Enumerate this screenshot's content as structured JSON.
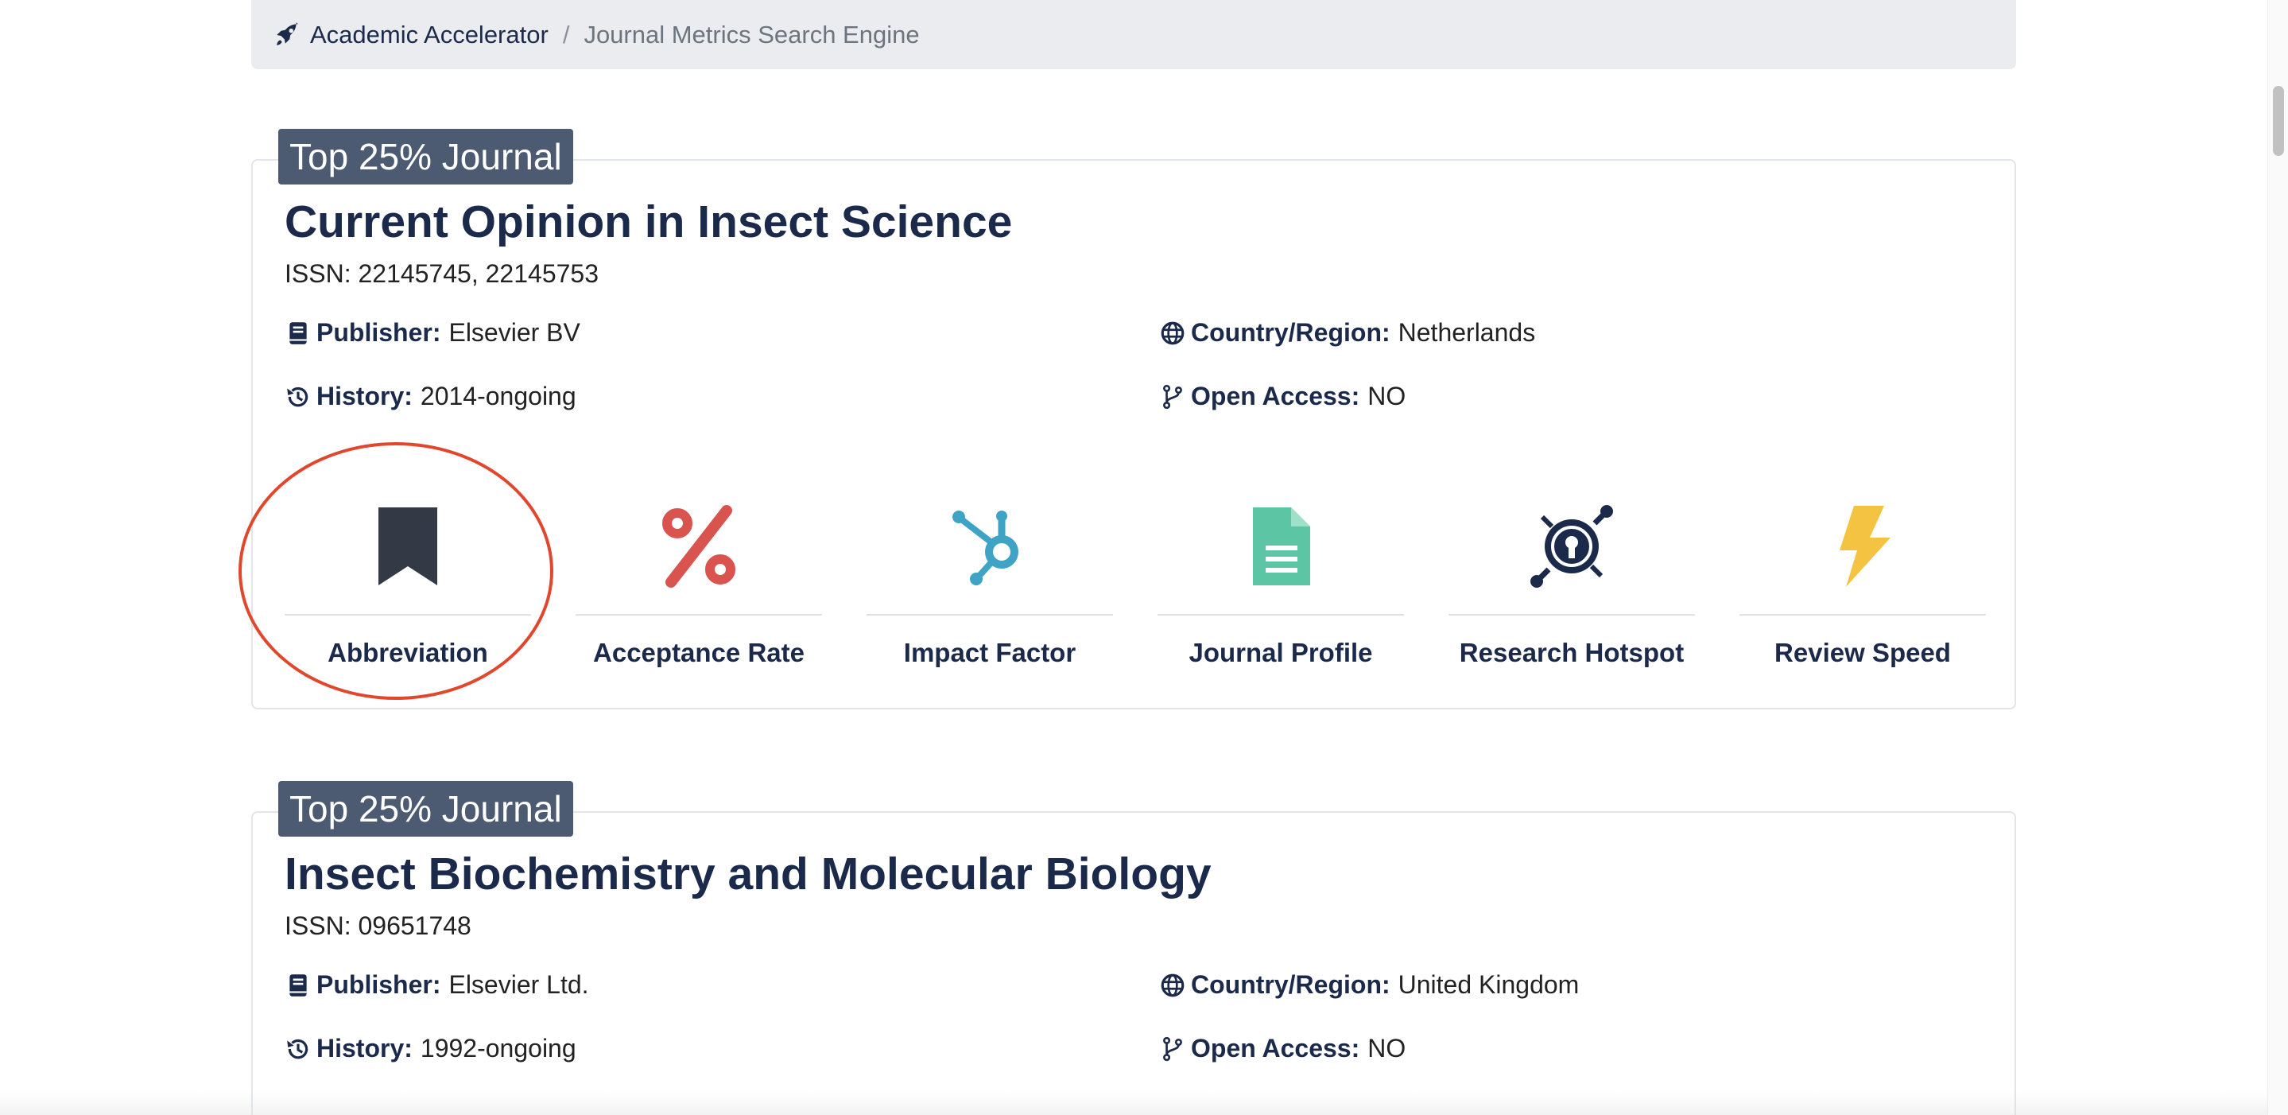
{
  "breadcrumb": {
    "home_label": "Academic Accelerator",
    "separator": "/",
    "current_label": "Journal Metrics Search Engine"
  },
  "journals": [
    {
      "badge": "Top 25% Journal",
      "title": "Current Opinion in Insect Science",
      "issn": "ISSN: 22145745, 22145753",
      "publisher_key": "Publisher:",
      "publisher": "Elsevier BV",
      "country_key": "Country/Region:",
      "country": "Netherlands",
      "history_key": "History:",
      "history": "2014-ongoing",
      "open_access_key": "Open Access:",
      "open_access": "NO",
      "actions": [
        {
          "label": "Abbreviation",
          "icon": "bookmark-icon",
          "color": "#343a45"
        },
        {
          "label": "Acceptance Rate",
          "icon": "percent-icon",
          "color": "#d9534f"
        },
        {
          "label": "Impact Factor",
          "icon": "hubspot-icon",
          "color": "#3ea3c4"
        },
        {
          "label": "Journal Profile",
          "icon": "file-icon",
          "color": "#5cc6a4"
        },
        {
          "label": "Research Hotspot",
          "icon": "keycdn-icon",
          "color": "#1b2a4a"
        },
        {
          "label": "Review Speed",
          "icon": "bolt-icon",
          "color": "#f5c342"
        }
      ]
    },
    {
      "badge": "Top 25% Journal",
      "title": "Insect Biochemistry and Molecular Biology",
      "issn": "ISSN: 09651748",
      "publisher_key": "Publisher:",
      "publisher": "Elsevier Ltd.",
      "country_key": "Country/Region:",
      "country": "United Kingdom",
      "history_key": "History:",
      "history": "1992-ongoing",
      "open_access_key": "Open Access:",
      "open_access": "NO"
    }
  ]
}
